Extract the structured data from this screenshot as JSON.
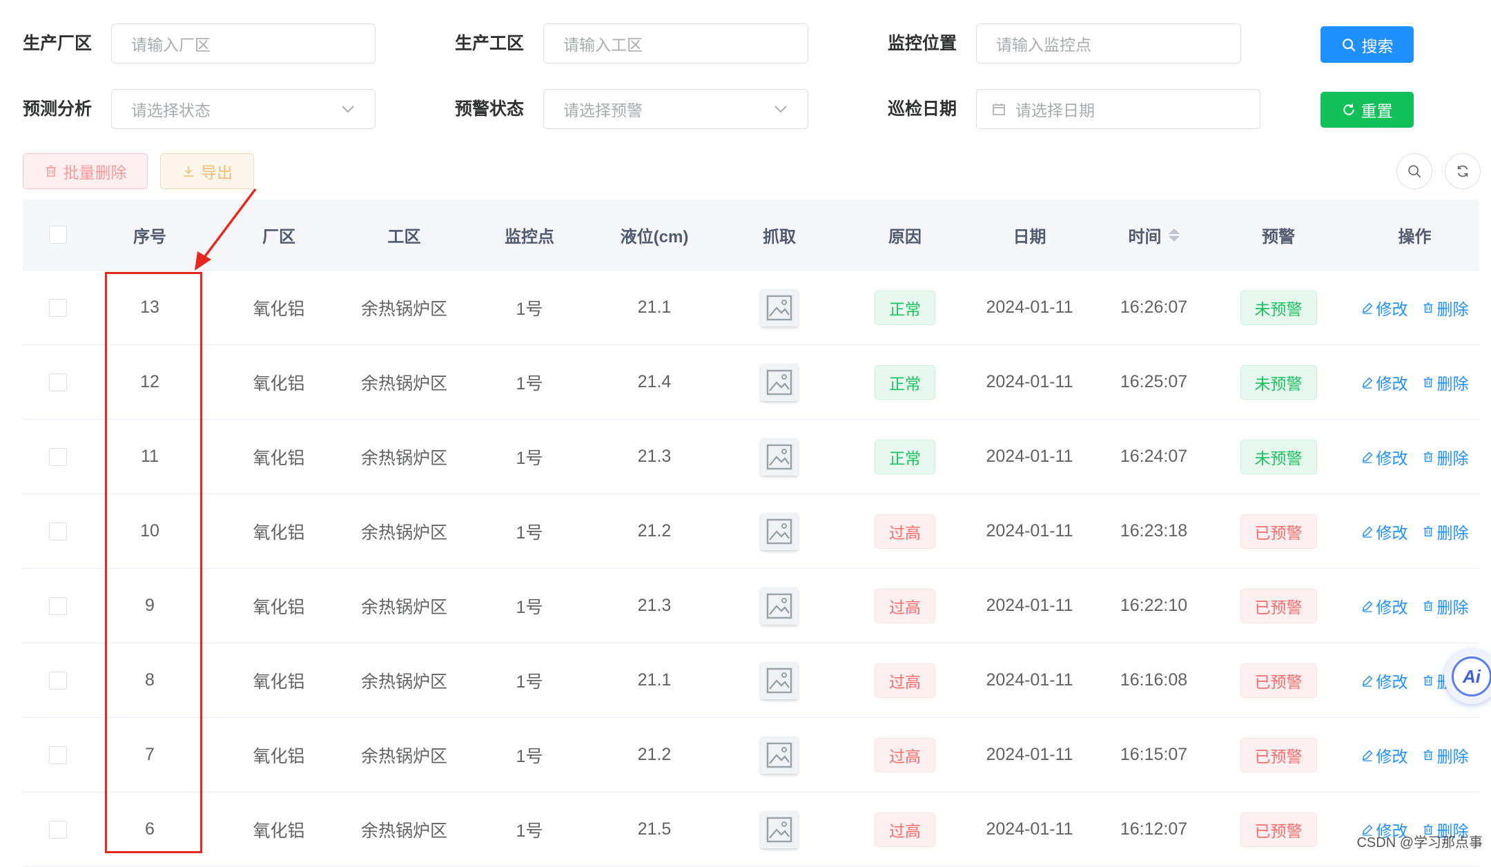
{
  "filters": {
    "factory": {
      "label": "生产厂区",
      "placeholder": "请输入厂区"
    },
    "workshop": {
      "label": "生产工区",
      "placeholder": "请输入工区"
    },
    "monitor": {
      "label": "监控位置",
      "placeholder": "请输入监控点"
    },
    "prediction": {
      "label": "预测分析",
      "placeholder": "请选择状态"
    },
    "warning": {
      "label": "预警状态",
      "placeholder": "请选择预警"
    },
    "date": {
      "label": "巡检日期",
      "placeholder": "请选择日期"
    },
    "search_label": "搜索",
    "reset_label": "重置"
  },
  "toolbar": {
    "batch_delete_label": "批量删除",
    "export_label": "导出"
  },
  "table": {
    "headers": [
      "序号",
      "厂区",
      "工区",
      "监控点",
      "液位(cm)",
      "抓取",
      "原因",
      "日期",
      "时间",
      "预警",
      "操作"
    ],
    "edit_label": "修改",
    "delete_label": "删除",
    "rows": [
      {
        "id": "13",
        "factory": "氧化铝",
        "area": "余热锅炉区",
        "point": "1号",
        "level": "21.1",
        "reason": "正常",
        "date": "2024-01-11",
        "time": "16:26:07",
        "warning": "未预警"
      },
      {
        "id": "12",
        "factory": "氧化铝",
        "area": "余热锅炉区",
        "point": "1号",
        "level": "21.4",
        "reason": "正常",
        "date": "2024-01-11",
        "time": "16:25:07",
        "warning": "未预警"
      },
      {
        "id": "11",
        "factory": "氧化铝",
        "area": "余热锅炉区",
        "point": "1号",
        "level": "21.3",
        "reason": "正常",
        "date": "2024-01-11",
        "time": "16:24:07",
        "warning": "未预警"
      },
      {
        "id": "10",
        "factory": "氧化铝",
        "area": "余热锅炉区",
        "point": "1号",
        "level": "21.2",
        "reason": "过高",
        "date": "2024-01-11",
        "time": "16:23:18",
        "warning": "已预警"
      },
      {
        "id": "9",
        "factory": "氧化铝",
        "area": "余热锅炉区",
        "point": "1号",
        "level": "21.3",
        "reason": "过高",
        "date": "2024-01-11",
        "time": "16:22:10",
        "warning": "已预警"
      },
      {
        "id": "8",
        "factory": "氧化铝",
        "area": "余热锅炉区",
        "point": "1号",
        "level": "21.1",
        "reason": "过高",
        "date": "2024-01-11",
        "time": "16:16:08",
        "warning": "已预警"
      },
      {
        "id": "7",
        "factory": "氧化铝",
        "area": "余热锅炉区",
        "point": "1号",
        "level": "21.2",
        "reason": "过高",
        "date": "2024-01-11",
        "time": "16:15:07",
        "warning": "已预警"
      },
      {
        "id": "6",
        "factory": "氧化铝",
        "area": "余热锅炉区",
        "point": "1号",
        "level": "21.5",
        "reason": "过高",
        "date": "2024-01-11",
        "time": "16:12:07",
        "warning": "已预警"
      }
    ]
  },
  "ai_badge": "Ai",
  "watermark": "CSDN @学习那点事"
}
